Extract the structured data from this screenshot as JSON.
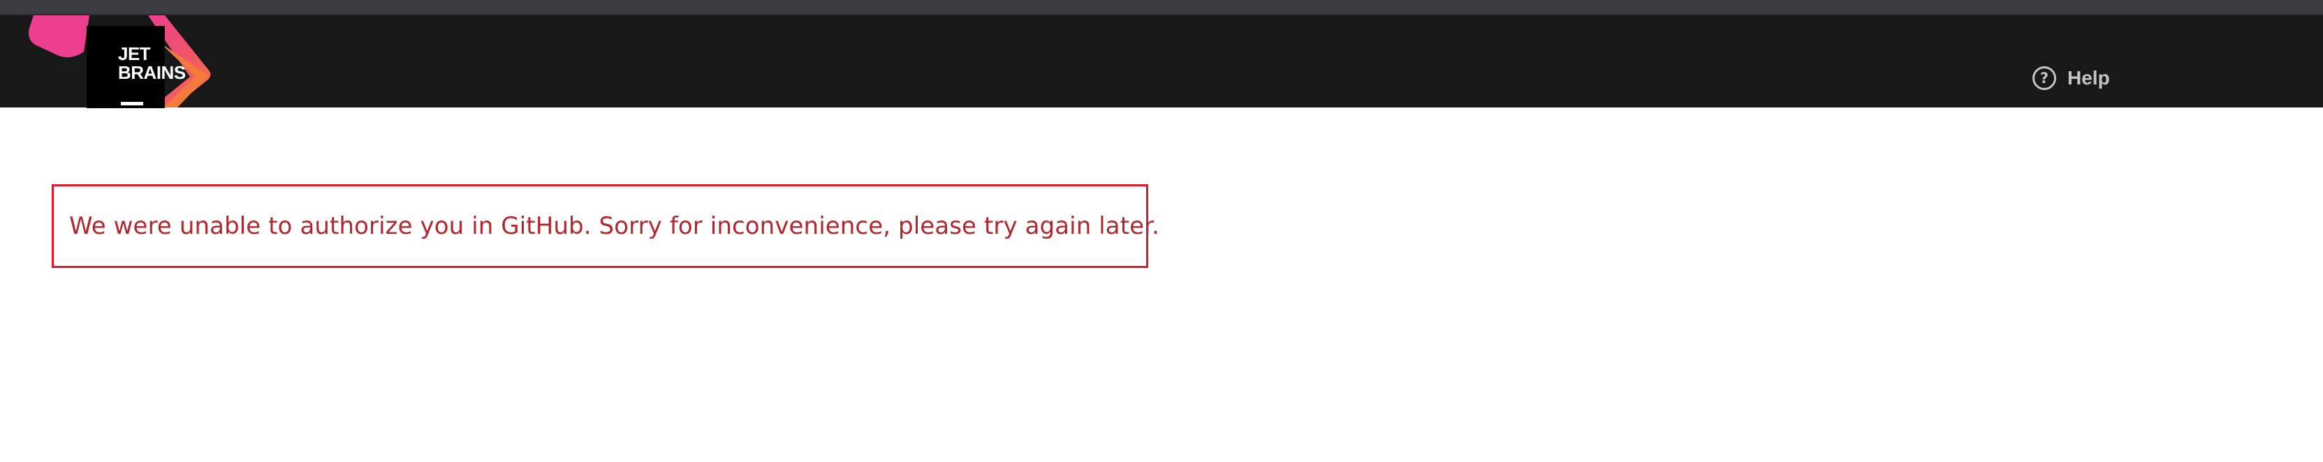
{
  "header": {
    "logo": {
      "line1": "JET",
      "line2": "BRAINS",
      "colors": {
        "pink": "#ee3e8f",
        "orange": "#f47b3b",
        "black": "#000000"
      }
    },
    "help": {
      "label": "Help",
      "icon": "question-circle-icon"
    },
    "background": "#181818"
  },
  "main": {
    "error_message": "We were unable to authorize you in GitHub. Sorry for inconvenience, please try again later.",
    "error_color": "#b0282f",
    "error_border_color": "#e0162b"
  }
}
